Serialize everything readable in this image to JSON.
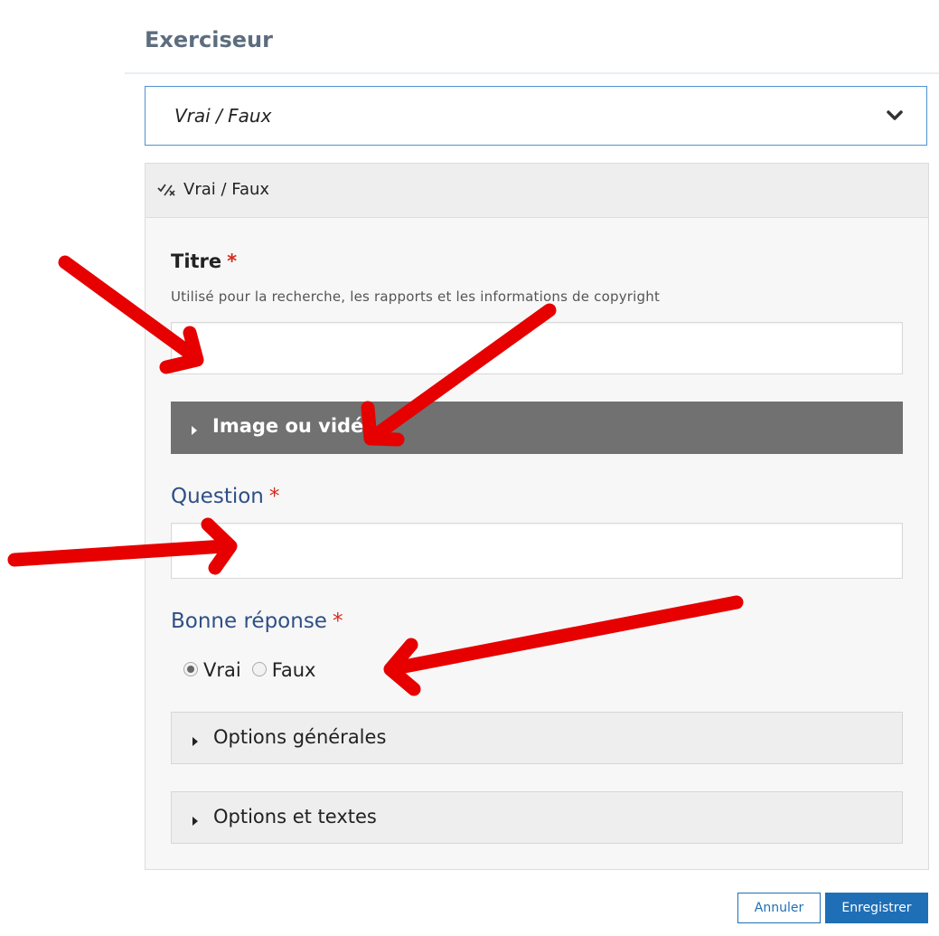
{
  "page": {
    "title": "Exerciseur"
  },
  "content_type_select": {
    "value": "Vrai / Faux"
  },
  "panel": {
    "header_label": "Vrai / Faux",
    "title_field": {
      "label": "Titre",
      "required_mark": "*",
      "description": "Utilisé pour la recherche, les rapports et les informations de copyright",
      "value": ""
    },
    "media_section": {
      "label": "Image ou vidéo"
    },
    "question_field": {
      "label": "Question",
      "required_mark": "*",
      "value": ""
    },
    "answer_field": {
      "label": "Bonne réponse",
      "required_mark": "*",
      "options": [
        "Vrai",
        "Faux"
      ],
      "selected": "Vrai"
    },
    "general_options": {
      "label": "Options générales"
    },
    "options_texts": {
      "label": "Options et textes"
    }
  },
  "actions": {
    "cancel_label": "Annuler",
    "save_label": "Enregistrer"
  },
  "colors": {
    "annotation_arrows": "#e60000",
    "primary": "#1f6fb6",
    "required": "#d52b1e"
  }
}
